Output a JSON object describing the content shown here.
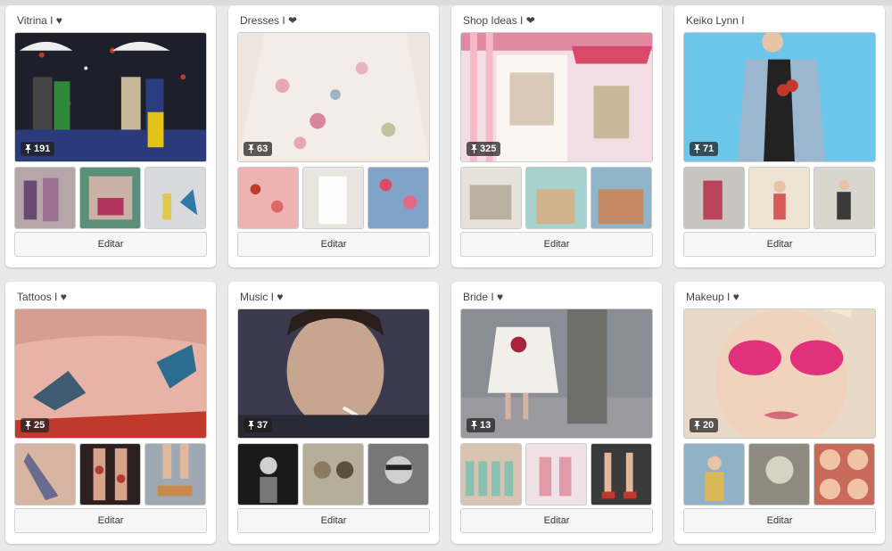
{
  "boards": [
    {
      "title": "Vitrina I ♥",
      "pins": "191",
      "edit_label": "Editar"
    },
    {
      "title": "Dresses I ❤",
      "pins": "63",
      "edit_label": "Editar"
    },
    {
      "title": "Shop Ideas I ❤",
      "pins": "325",
      "edit_label": "Editar"
    },
    {
      "title": "Keiko Lynn I",
      "pins": "71",
      "edit_label": "Editar"
    },
    {
      "title": "Tattoos I ♥",
      "pins": "25",
      "edit_label": "Editar"
    },
    {
      "title": "Music I ♥",
      "pins": "37",
      "edit_label": "Editar"
    },
    {
      "title": "Bride I ♥",
      "pins": "13",
      "edit_label": "Editar"
    },
    {
      "title": "Makeup I ♥",
      "pins": "20",
      "edit_label": "Editar"
    }
  ],
  "icons": {
    "pin": "pushpin-icon"
  }
}
